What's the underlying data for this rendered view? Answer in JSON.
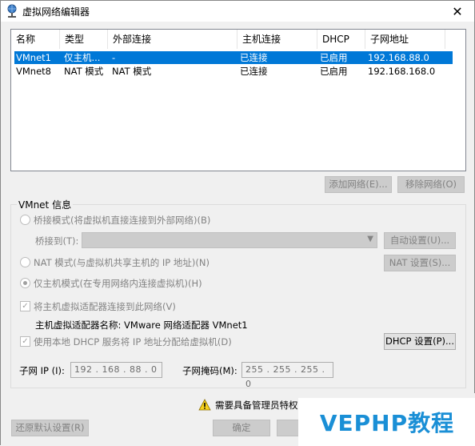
{
  "window": {
    "title": "虚拟网络编辑器",
    "close_glyph": "✕"
  },
  "list": {
    "columns": [
      "名称",
      "类型",
      "外部连接",
      "主机连接",
      "DHCP",
      "子网地址"
    ],
    "rows": [
      {
        "name": "VMnet1",
        "type": "仅主机...",
        "external": "-",
        "host": "已连接",
        "dhcp": "已启用",
        "subnet": "192.168.88.0",
        "selected": true
      },
      {
        "name": "VMnet8",
        "type": "NAT 模式",
        "external": "NAT 模式",
        "host": "已连接",
        "dhcp": "已启用",
        "subnet": "192.168.168.0",
        "selected": false
      }
    ]
  },
  "buttons": {
    "add_network": "添加网络(E)...",
    "remove_network": "移除网络(O)",
    "auto_settings": "自动设置(U)...",
    "nat_settings": "NAT 设置(S)...",
    "dhcp_settings": "DHCP 设置(P)...",
    "restore_defaults": "还原默认设置(R)",
    "ok": "确定"
  },
  "vmnet_info": {
    "group_label": "VMnet 信息",
    "bridged_label": "桥接模式(将虚拟机直接连接到外部网络)(B)",
    "bridged_to_label": "桥接到(T):",
    "nat_label": "NAT 模式(与虚拟机共享主机的 IP 地址)(N)",
    "hostonly_label": "仅主机模式(在专用网络内连接虚拟机)(H)",
    "connect_adapter_label": "将主机虚拟适配器连接到此网络(V)",
    "adapter_name_label": "主机虚拟适配器名称: VMware 网络适配器 VMnet1",
    "use_dhcp_label": "使用本地 DHCP 服务将 IP 地址分配给虚拟机(D)",
    "subnet_ip_label": "子网 IP (I):",
    "subnet_ip_value": "192 . 168 . 88  .  0",
    "subnet_mask_label": "子网掩码(M):",
    "subnet_mask_value": "255 . 255 . 255 .  0"
  },
  "status": {
    "warning_text": "需要具备管理员特权"
  },
  "watermark": {
    "text": "VEPHP教程"
  },
  "colors": {
    "selection": "#0078d7",
    "watermark": "#1a8fd6"
  }
}
